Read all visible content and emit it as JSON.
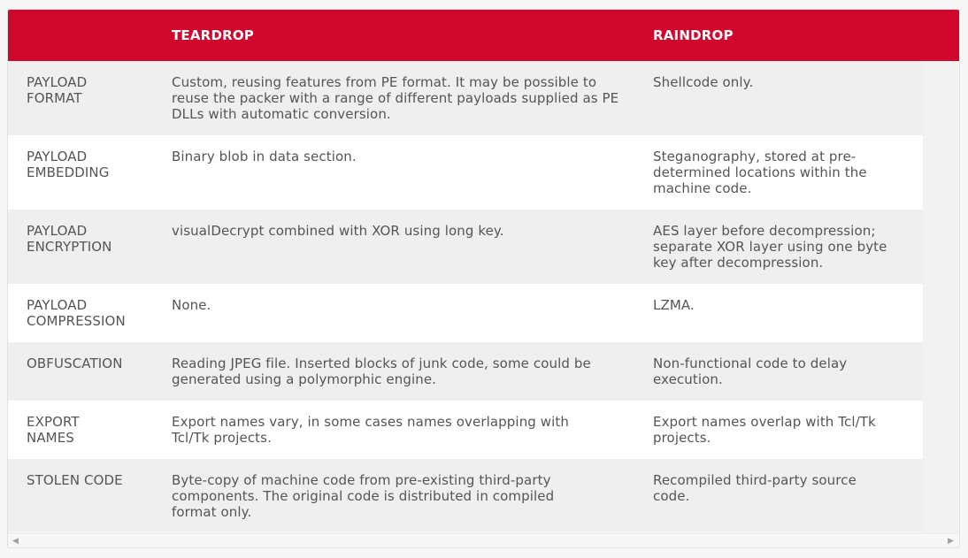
{
  "header": {
    "col1": "",
    "col2": "TEARDROP",
    "col3": "RAINDROP"
  },
  "rows": [
    {
      "feature": "PAYLOAD FORMAT",
      "teardrop": "Custom, reusing features from PE format. It may be possible to reuse the packer with a range of different payloads supplied as PE DLLs with automatic conversion.",
      "raindrop": "Shellcode only."
    },
    {
      "feature": "PAYLOAD EMBEDDING",
      "teardrop": "Binary blob in data section.",
      "raindrop": "Steganography, stored at pre-determined locations within the machine code."
    },
    {
      "feature": "PAYLOAD ENCRYPTION",
      "teardrop": "visualDecrypt combined with XOR using long key.",
      "raindrop": "AES layer before decompression; separate XOR layer using one byte key after decompression."
    },
    {
      "feature": "PAYLOAD COMPRESSION",
      "teardrop": "None.",
      "raindrop": "LZMA."
    },
    {
      "feature": "OBFUSCATION",
      "teardrop": "Reading JPEG file. Inserted blocks of junk code, some could be generated using a polymorphic engine.",
      "raindrop": "Non-functional code to delay execution."
    },
    {
      "feature": "EXPORT NAMES",
      "teardrop": "Export names vary, in some cases names overlapping with Tcl/Tk projects.",
      "raindrop": "Export names overlap with Tcl/Tk projects."
    },
    {
      "feature": "STOLEN CODE",
      "teardrop": "Byte-copy of machine code from pre-existing third-party components. The original code is distributed in compiled format only.",
      "raindrop": "Recompiled third-party source code."
    }
  ],
  "scrollbar": {
    "left_arrow": "◀",
    "right_arrow": "▶"
  },
  "colors": {
    "header_bg": "#d0062d",
    "header_text": "#ffffff",
    "row_odd": "#efefef",
    "row_even": "#ffffff",
    "cell_text": "#555555"
  }
}
